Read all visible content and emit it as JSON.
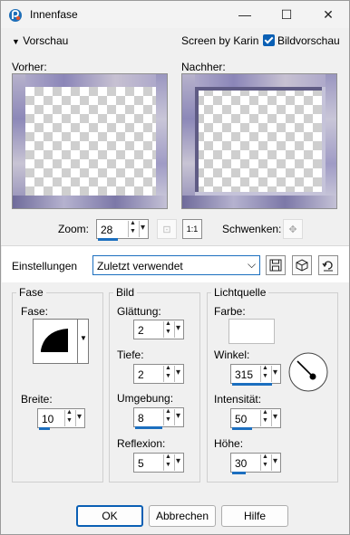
{
  "window": {
    "title": "Innenfase"
  },
  "titlebar": {
    "minimize_glyph": "—",
    "maximize_glyph": "☐",
    "close_glyph": "✕"
  },
  "preview_bar": {
    "toggle_label": "Vorschau",
    "credit": "Screen by Karin",
    "checkbox_label": "Bildvorschau",
    "checkbox_checked": true
  },
  "previews": {
    "before_label": "Vorher:",
    "after_label": "Nachher:"
  },
  "zoom": {
    "label": "Zoom:",
    "value": "28",
    "pan_label": "Schwenken:",
    "one_to_one": "1:1"
  },
  "settings": {
    "label": "Einstellungen",
    "preset_value": "Zuletzt verwendet"
  },
  "fase": {
    "group_title": "Fase",
    "shape_label": "Fase:",
    "breite_label": "Breite:",
    "breite_value": "10"
  },
  "bild": {
    "group_title": "Bild",
    "glaettung_label": "Glättung:",
    "glaettung_value": "2",
    "tiefe_label": "Tiefe:",
    "tiefe_value": "2",
    "umgebung_label": "Umgebung:",
    "umgebung_value": "8",
    "reflexion_label": "Reflexion:",
    "reflexion_value": "5"
  },
  "licht": {
    "group_title": "Lichtquelle",
    "farbe_label": "Farbe:",
    "farbe_color": "#ffffff",
    "winkel_label": "Winkel:",
    "winkel_value": "315",
    "intensitaet_label": "Intensität:",
    "intensitaet_value": "50",
    "hoehe_label": "Höhe:",
    "hoehe_value": "30"
  },
  "buttons": {
    "ok": "OK",
    "abbrechen": "Abbrechen",
    "hilfe": "Hilfe"
  },
  "colors": {
    "accent": "#0a5fb4"
  }
}
